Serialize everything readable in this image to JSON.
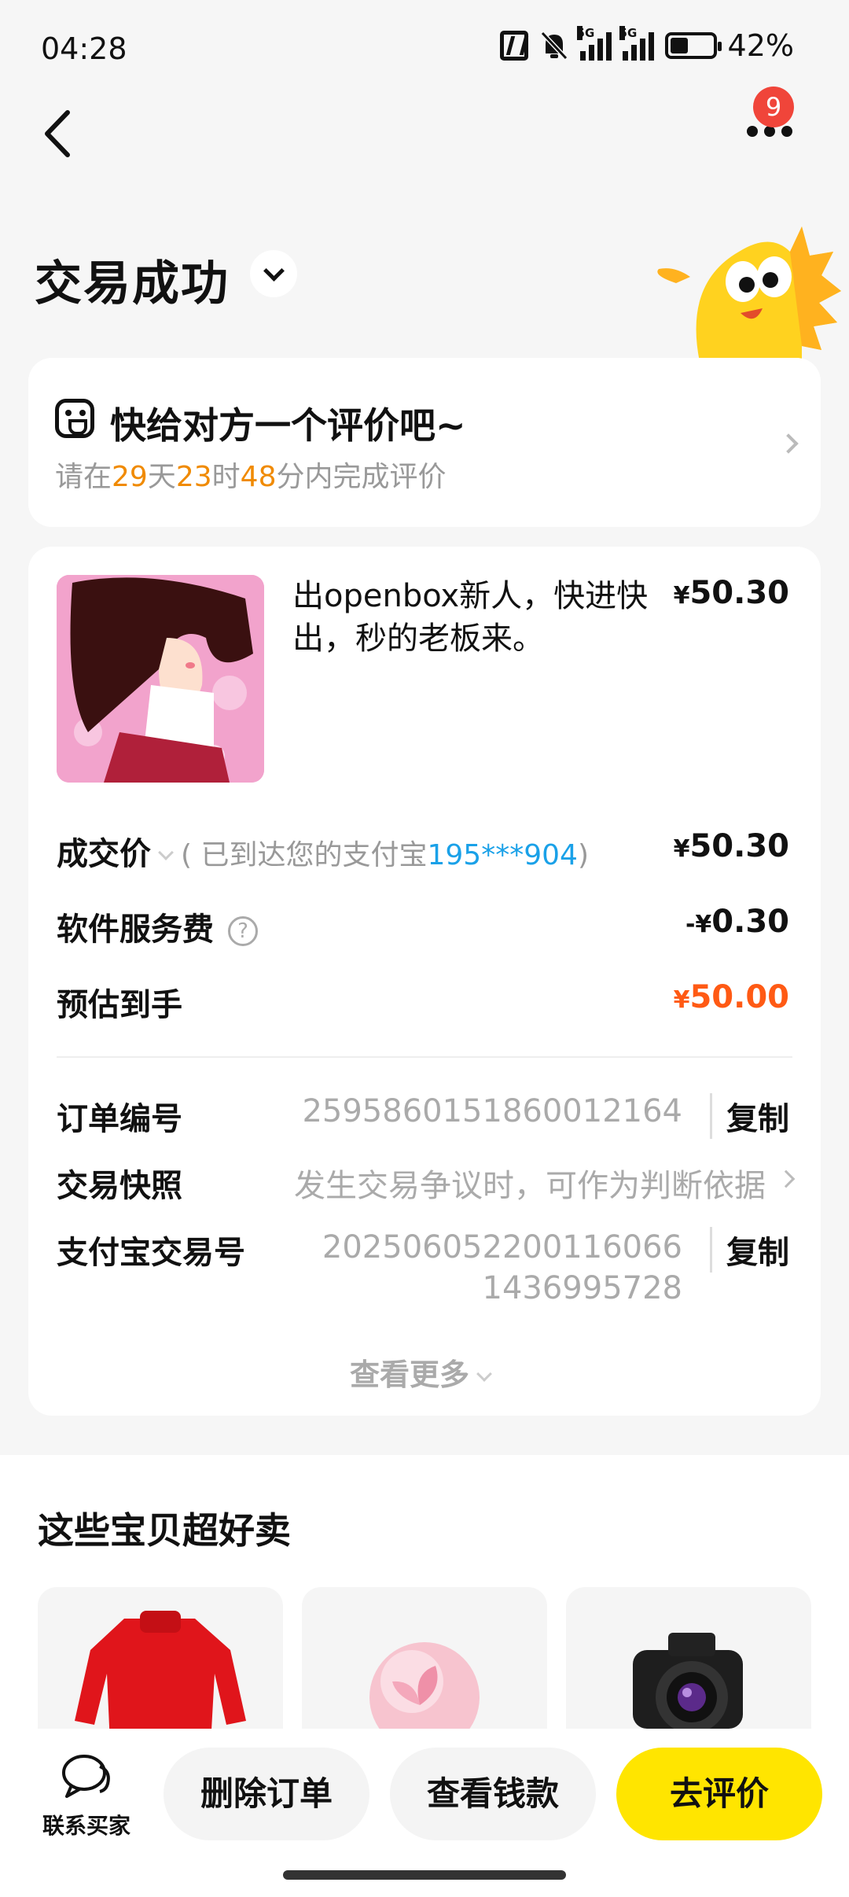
{
  "status_bar": {
    "time": "04:28",
    "network_1": "5G",
    "network_2": "5G",
    "battery": "42%"
  },
  "header": {
    "notification_count": "9"
  },
  "status": {
    "title": "交易成功"
  },
  "review_prompt": {
    "title": "快给对方一个评价吧~",
    "prefix": "请在",
    "days": "29",
    "days_unit": "天",
    "hours": "23",
    "hours_unit": "时",
    "minutes": "48",
    "suffix": "分内完成评价"
  },
  "item": {
    "title": "出openbox新人，快进快出，秒的老板来。",
    "price_symbol": "¥",
    "price": "50.30"
  },
  "amounts": {
    "deal_price_label": "成交价",
    "deal_hint_open": "( 已到达您的支付宝",
    "deal_hint_account": "195***904",
    "deal_hint_close": ")",
    "deal_price_symbol": "¥",
    "deal_price": "50.30",
    "fee_label": "软件服务费",
    "fee_prefix": "-¥",
    "fee": "0.30",
    "estimate_label": "预估到手",
    "estimate_symbol": "¥",
    "estimate": "50.00"
  },
  "order": {
    "order_no_label": "订单编号",
    "order_no": "2595860151860012164",
    "copy_label": "复制",
    "snapshot_label": "交易快照",
    "snapshot_hint": "发生交易争议时，可作为判断依据",
    "alipay_no_label": "支付宝交易号",
    "alipay_no_line1": "202506052200116066",
    "alipay_no_line2": "1436995728",
    "see_more": "查看更多"
  },
  "recommendations": {
    "title": "这些宝贝超好卖"
  },
  "bottom_bar": {
    "contact_label": "联系买家",
    "delete_label": "删除订单",
    "view_money_label": "查看钱款",
    "review_label": "去评价"
  },
  "colors": {
    "accent_yellow": "#ffe500",
    "countdown_orange": "#f08a00",
    "price_red": "#ff5a14",
    "link_blue": "#1aa1e8"
  }
}
